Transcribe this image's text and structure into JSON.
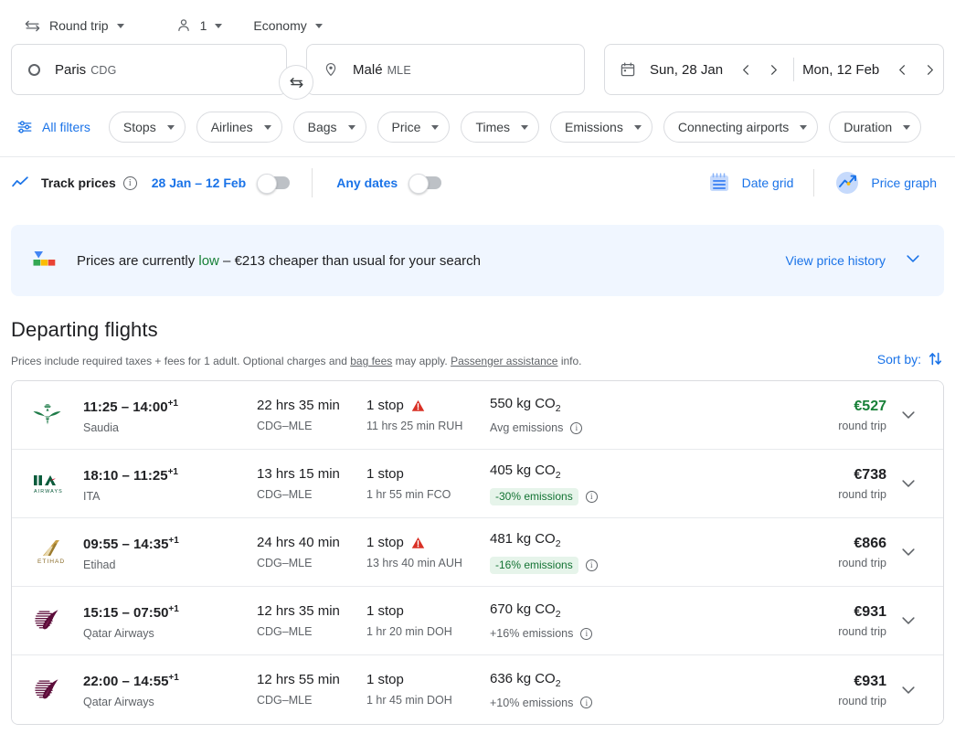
{
  "options": {
    "trip_type": "Round trip",
    "passengers": "1",
    "cabin": "Economy",
    "trip_icon": "swap-horizontal-icon",
    "pax_icon": "person-icon"
  },
  "search": {
    "origin_city": "Paris",
    "origin_code": "CDG",
    "destination_city": "Malé",
    "destination_code": "MLE",
    "depart_date": "Sun, 28 Jan",
    "return_date": "Mon, 12 Feb",
    "swap_icon": "swap-arrows-icon",
    "calendar_icon": "calendar-icon"
  },
  "filters": {
    "all_filters": "All filters",
    "chips": [
      {
        "label": "Stops"
      },
      {
        "label": "Airlines"
      },
      {
        "label": "Bags"
      },
      {
        "label": "Price"
      },
      {
        "label": "Times"
      },
      {
        "label": "Emissions"
      },
      {
        "label": "Connecting airports"
      },
      {
        "label": "Duration"
      }
    ]
  },
  "track": {
    "label": "Track prices",
    "date_range": "28 Jan – 12 Feb",
    "any_dates": "Any dates",
    "date_grid": "Date grid",
    "price_graph": "Price graph",
    "info_glyph": "i",
    "track_toggle_on": false,
    "any_dates_toggle_on": false
  },
  "banner": {
    "text_before": "Prices are currently ",
    "highlight": "low",
    "text_after": " – €213 cheaper than usual for your search",
    "link": "View price history",
    "indicator_icon": "price-level-indicator-icon",
    "accent_green": "#188038"
  },
  "departing": {
    "title": "Departing flights",
    "disclaimer_1": "Prices include required taxes + fees for 1 adult. Optional charges and ",
    "bag_fees_link": "bag fees",
    "disclaimer_2": " may apply. ",
    "assistance_link": "Passenger assistance",
    "disclaimer_3": " info.",
    "sort_by": "Sort by:"
  },
  "flights": [
    {
      "airline": "Saudia",
      "logo": "saudia-logo",
      "times": "11:25 – 14:00",
      "next_day": "+1",
      "duration": "22 hrs 35 min",
      "route": "CDG–MLE",
      "stops": "1 stop",
      "warning": true,
      "layover": "11 hrs 25 min RUH",
      "co2": "550 kg CO",
      "co2_sub": "2",
      "emissions_label": "Avg emissions",
      "emissions_badge": false,
      "price": "€527",
      "price_green": true,
      "price_note": "round trip"
    },
    {
      "airline": "ITA",
      "logo": "ita-airways-logo",
      "times": "18:10 – 11:25",
      "next_day": "+1",
      "duration": "13 hrs 15 min",
      "route": "CDG–MLE",
      "stops": "1 stop",
      "warning": false,
      "layover": "1 hr 55 min FCO",
      "co2": "405 kg CO",
      "co2_sub": "2",
      "emissions_label": "-30% emissions",
      "emissions_badge": true,
      "price": "€738",
      "price_green": false,
      "price_note": "round trip"
    },
    {
      "airline": "Etihad",
      "logo": "etihad-logo",
      "times": "09:55 – 14:35",
      "next_day": "+1",
      "duration": "24 hrs 40 min",
      "route": "CDG–MLE",
      "stops": "1 stop",
      "warning": true,
      "layover": "13 hrs 40 min AUH",
      "co2": "481 kg CO",
      "co2_sub": "2",
      "emissions_label": "-16% emissions",
      "emissions_badge": true,
      "price": "€866",
      "price_green": false,
      "price_note": "round trip"
    },
    {
      "airline": "Qatar Airways",
      "logo": "qatar-airways-logo",
      "times": "15:15 – 07:50",
      "next_day": "+1",
      "duration": "12 hrs 35 min",
      "route": "CDG–MLE",
      "stops": "1 stop",
      "warning": false,
      "layover": "1 hr 20 min DOH",
      "co2": "670 kg CO",
      "co2_sub": "2",
      "emissions_label": "+16% emissions",
      "emissions_badge": false,
      "price": "€931",
      "price_green": false,
      "price_note": "round trip"
    },
    {
      "airline": "Qatar Airways",
      "logo": "qatar-airways-logo",
      "times": "22:00 – 14:55",
      "next_day": "+1",
      "duration": "12 hrs 55 min",
      "route": "CDG–MLE",
      "stops": "1 stop",
      "warning": false,
      "layover": "1 hr 45 min DOH",
      "co2": "636 kg CO",
      "co2_sub": "2",
      "emissions_label": "+10% emissions",
      "emissions_badge": false,
      "price": "€931",
      "price_green": false,
      "price_note": "round trip"
    }
  ]
}
